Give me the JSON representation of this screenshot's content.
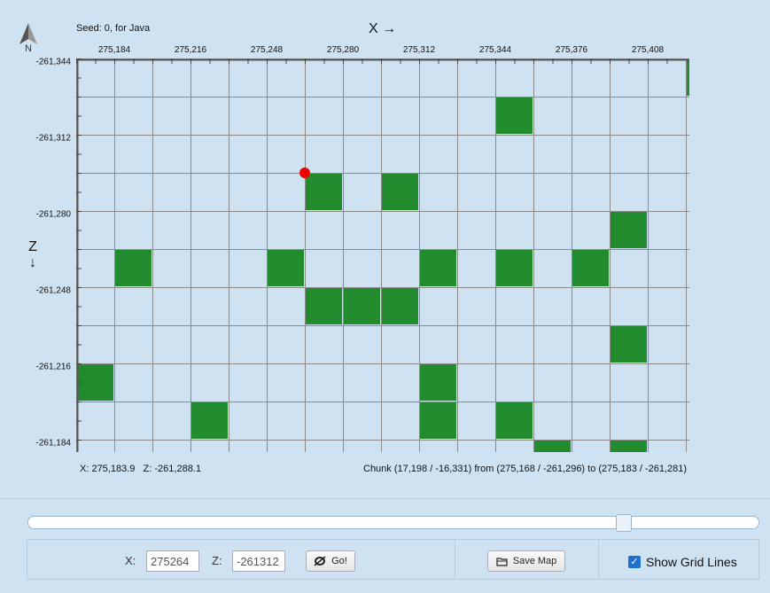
{
  "header": {
    "compass_letter": "N",
    "seed_text": "Seed: 0, for Java",
    "x_axis_title": "X →",
    "z_axis_title_letter": "Z",
    "z_axis_title_arrow": "↓"
  },
  "map": {
    "x_ticks": [
      "275,184",
      "275,216",
      "275,248",
      "275,280",
      "275,312",
      "275,344",
      "275,376",
      "275,408"
    ],
    "z_ticks": [
      "-261,344",
      "-261,312",
      "-261,280",
      "-261,248",
      "-261,216",
      "-261,184"
    ],
    "x_start": 275168,
    "z_start": -261344,
    "block_size": 16,
    "chunk_size": 16,
    "cols": 16,
    "rows": 10,
    "marker": {
      "x": 275264,
      "z": -261296
    },
    "filled_chunks": [
      [
        16,
        0
      ],
      [
        11,
        1
      ],
      [
        6,
        3
      ],
      [
        8,
        3
      ],
      [
        14,
        4
      ],
      [
        1,
        5
      ],
      [
        5,
        5
      ],
      [
        9,
        5
      ],
      [
        11,
        5
      ],
      [
        13,
        5
      ],
      [
        6,
        6
      ],
      [
        7,
        6
      ],
      [
        8,
        6
      ],
      [
        14,
        7
      ],
      [
        9,
        8
      ],
      [
        0,
        8
      ],
      [
        3,
        9
      ],
      [
        9,
        9
      ],
      [
        11,
        9
      ],
      [
        12,
        10
      ],
      [
        14,
        10
      ]
    ],
    "filled_color": "#228b2d",
    "grid_color": "#8a8a8a",
    "marker_color": "#ee0000"
  },
  "status": {
    "cursor_readout": "X: 275,183.9   Z: -261,288.1",
    "chunk_info": "Chunk (17,198 / -16,331) from (275,168 / -261,296) to (275,183 / -261,281)"
  },
  "controls": {
    "zoom_level_fraction": 0.82,
    "x_label": "X:",
    "x_value": "275264",
    "z_label": "Z:",
    "z_value": "-261312",
    "go_label": "Go!",
    "save_label": "Save Map",
    "grid_checkbox_label": "Show Grid Lines",
    "grid_checked": true
  }
}
